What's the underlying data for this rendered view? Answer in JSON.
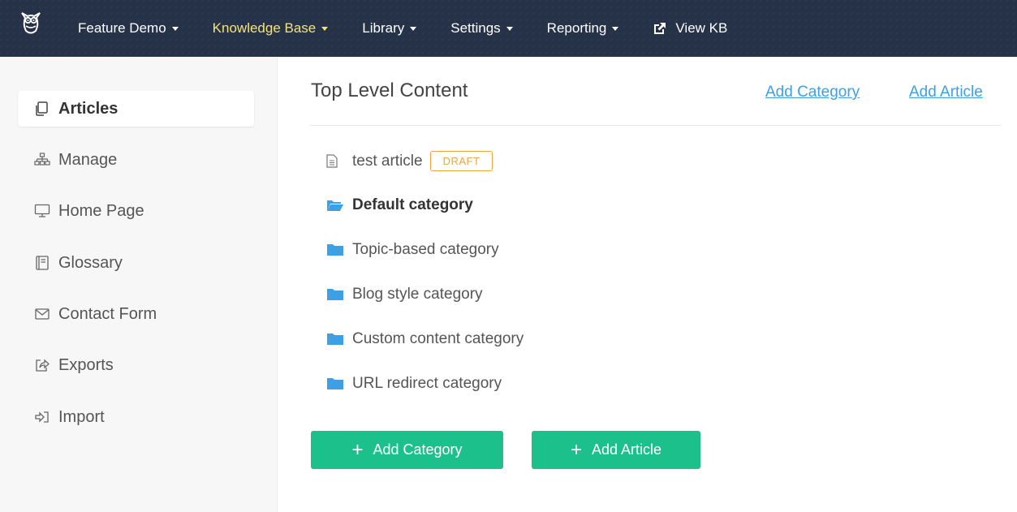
{
  "topnav": {
    "items": [
      {
        "label": "Feature Demo"
      },
      {
        "label": "Knowledge Base",
        "active": true
      },
      {
        "label": "Library"
      },
      {
        "label": "Settings"
      },
      {
        "label": "Reporting"
      }
    ],
    "view_kb": "View KB",
    "colors": {
      "background": "#263247",
      "active_text": "#f3e37a"
    }
  },
  "sidebar": {
    "items": [
      {
        "label": "Articles",
        "icon": "copy-icon",
        "active": true
      },
      {
        "label": "Manage",
        "icon": "sitemap-icon"
      },
      {
        "label": "Home Page",
        "icon": "monitor-icon"
      },
      {
        "label": "Glossary",
        "icon": "book-icon"
      },
      {
        "label": "Contact Form",
        "icon": "envelope-icon"
      },
      {
        "label": "Exports",
        "icon": "share-icon"
      },
      {
        "label": "Import",
        "icon": "sign-in-icon"
      }
    ]
  },
  "main": {
    "title": "Top Level Content",
    "header_links": {
      "add_category": "Add Category",
      "add_article": "Add Article"
    },
    "article": {
      "label": "test article",
      "badge": "DRAFT"
    },
    "categories": [
      {
        "label": "Default category",
        "icon": "folder-open-icon",
        "bold": true
      },
      {
        "label": "Topic-based category",
        "icon": "folder-icon"
      },
      {
        "label": "Blog style category",
        "icon": "folder-icon"
      },
      {
        "label": "Custom content category",
        "icon": "folder-icon"
      },
      {
        "label": "URL redirect category",
        "icon": "folder-icon"
      }
    ],
    "buttons": {
      "add_category": "Add Category",
      "add_article": "Add Article"
    },
    "colors": {
      "link": "#3ea0e4",
      "button": "#1bc08b",
      "folder": "#3ea0e4",
      "draft": "#f0a53b"
    }
  }
}
